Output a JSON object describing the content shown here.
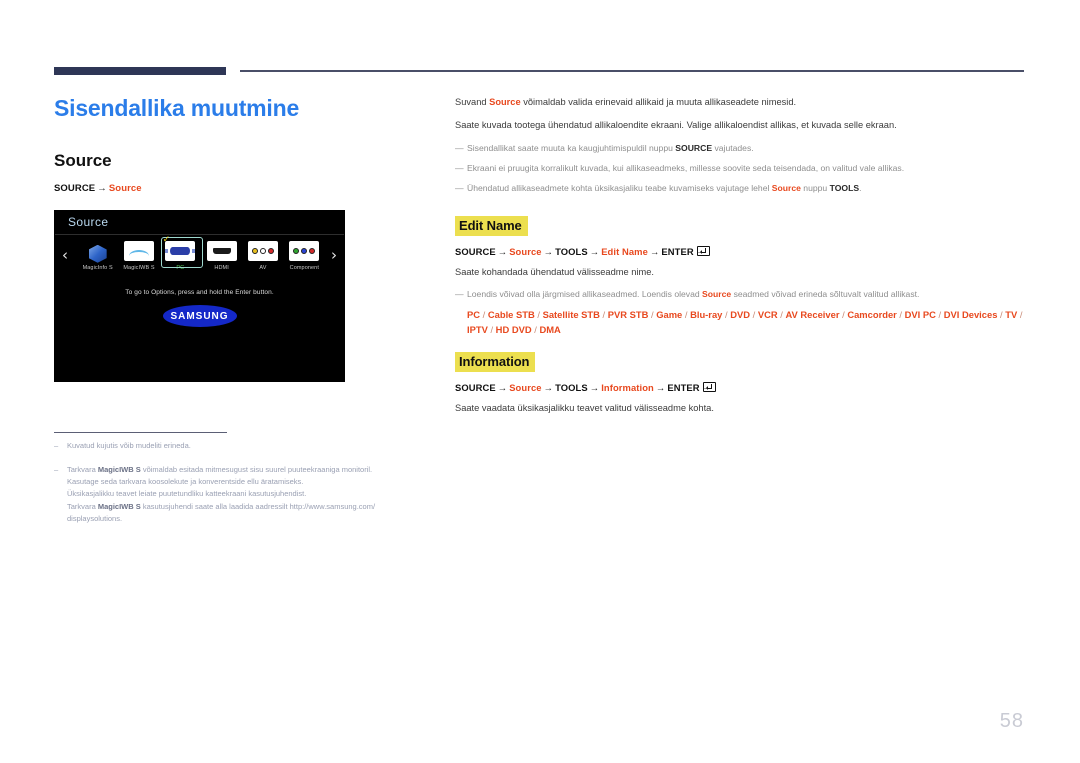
{
  "header": {
    "accent_color": "#2e3656",
    "rule_color": "#4a4f68"
  },
  "left": {
    "page_title": "Sisendallika muutmine",
    "section_heading": "Source",
    "path": {
      "source_label": "SOURCE",
      "arrow": "→",
      "target_label": "Source"
    },
    "tv": {
      "menu_title": "Source",
      "prev_arrow": "‹",
      "next_arrow": "›",
      "check_mark": "✓",
      "items": [
        {
          "label": "MagicInfo S",
          "icon": "magicinfo-cube-icon",
          "selected": false
        },
        {
          "label": "MagicIWB S",
          "icon": "wave-icon",
          "selected": false
        },
        {
          "label": "PC",
          "icon": "vga-connector-icon",
          "selected": true
        },
        {
          "label": "HDMI",
          "icon": "hdmi-port-icon",
          "selected": false
        },
        {
          "label": "AV",
          "icon": "rca-av-jacks-icon",
          "selected": false
        },
        {
          "label": "Component",
          "icon": "rca-component-jacks-icon",
          "selected": false
        }
      ],
      "hint": "To go to Options, press and hold the Enter button.",
      "brand": "SAMSUNG"
    },
    "footnotes": [
      {
        "dash": "–",
        "lines": [
          {
            "text": "Kuvatud kujutis võib mudeliti erineda."
          }
        ]
      },
      {
        "dash": "–",
        "lines": [
          {
            "pre": "Tarkvara ",
            "bold": "MagicIWB S",
            "post": " võimaldab esitada mitmesugust sisu suurel puuteekraaniga monitoril."
          },
          {
            "text": "Kasutage seda tarkvara koosolekute ja konverentside ellu äratamiseks."
          },
          {
            "text": "Üksikasjalikku teavet leiate puutetundliku katteekraani kasutusjuhendist."
          },
          {
            "pre": "Tarkvara ",
            "bold": "MagicIWB S",
            "post": " kasutusjuhendi saate alla laadida aadressilt http://www.samsung.com/"
          },
          {
            "text": "displaysolutions."
          }
        ]
      }
    ]
  },
  "right": {
    "intro": [
      {
        "pre": "Suvand ",
        "hl": "Source",
        "post": " võimaldab valida erinevaid allikaid ja muuta allikaseadete nimesid."
      },
      {
        "pre": "",
        "hl": "",
        "post": "Saate kuvada tootega ühendatud allikaloendite ekraani. Valige allikaloendist allikas, et kuvada selle ekraan."
      }
    ],
    "notes": [
      {
        "emdash": "—",
        "pre": "Sisendallikat saate muuta ka kaugjuhtimispuldil nuppu ",
        "bold": "SOURCE",
        "post": " vajutades."
      },
      {
        "emdash": "—",
        "pre": "Ekraani ei pruugita korralikult kuvada, kui allikaseadmeks, millesse soovite seda teisendada, on valitud vale allikas.",
        "bold": "",
        "post": ""
      },
      {
        "emdash": "—",
        "pre": "Ühendatud allikaseadmete kohta üksikasjaliku teabe kuvamiseks vajutage lehel ",
        "hl": "Source",
        "mid": " nuppu ",
        "bold": "TOOLS",
        "post": "."
      }
    ],
    "edit_name": {
      "title": "Edit Name",
      "highlight_color": "#ecdf4f",
      "path": {
        "p1": "SOURCE",
        "a1": "→",
        "p2": "Source",
        "a2": "→",
        "p3": "TOOLS",
        "a3": "→",
        "p4": "Edit Name",
        "a4": "→",
        "p5": "ENTER"
      },
      "description": "Saate kohandada ühendatud välisseadme nime.",
      "note": {
        "emdash": "—",
        "pre": "Loendis võivad olla järgmised allikaseadmed. Loendis olevad ",
        "hl": "Source",
        "post": " seadmed võivad erineda sõltuvalt valitud allikast."
      },
      "devices": [
        "PC",
        "Cable STB",
        "Satellite STB",
        "PVR STB",
        "Game",
        "Blu-ray",
        "DVD",
        "VCR",
        "AV Receiver",
        "Camcorder",
        "DVI PC",
        "DVI Devices",
        "TV",
        "IPTV",
        "HD DVD",
        "DMA"
      ]
    },
    "information": {
      "title": "Information",
      "highlight_color": "#ecdf4f",
      "path": {
        "p1": "SOURCE",
        "a1": "→",
        "p2": "Source",
        "a2": "→",
        "p3": "TOOLS",
        "a3": "→",
        "p4": "Information",
        "a4": "→",
        "p5": "ENTER"
      },
      "description": "Saate vaadata üksikasjalikku teavet valitud välisseadme kohta."
    }
  },
  "footer": {
    "page_number": "58"
  }
}
